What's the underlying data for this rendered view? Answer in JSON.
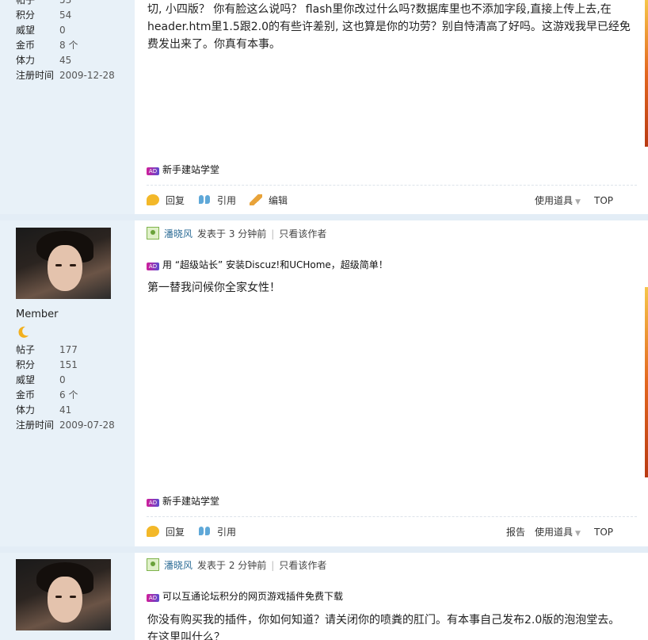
{
  "post1": {
    "stats": [
      {
        "label": "积分",
        "value": "54"
      },
      {
        "label": "威望",
        "value": "0"
      },
      {
        "label": "金币",
        "value": "8 个"
      },
      {
        "label": "体力",
        "value": "45"
      },
      {
        "label": "注册时间",
        "value": "2009-12-28"
      }
    ],
    "body": "切, 小四版？ 你有脸这么说吗？ flash里你改过什么吗?数据库里也不添加字段,直接上传上去,在header.htm里1.5跟2.0的有些许差别, 这也算是你的功劳？别自恃清高了好吗。这游戏我早已经免费发出来了。你真有本事。",
    "ad_bottom": "新手建站学堂",
    "actions": {
      "reply": "回复",
      "quote": "引用",
      "edit": "编辑",
      "tools": "使用道具",
      "top": "TOP"
    }
  },
  "post2": {
    "rank": "Member",
    "stats": [
      {
        "label": "帖子",
        "value": "177"
      },
      {
        "label": "积分",
        "value": "151"
      },
      {
        "label": "威望",
        "value": "0"
      },
      {
        "label": "金币",
        "value": "6 个"
      },
      {
        "label": "体力",
        "value": "41"
      },
      {
        "label": "注册时间",
        "value": "2009-07-28"
      }
    ],
    "author": "潘晓风",
    "posted": "发表于  3 分钟前",
    "only_author": "只看该作者",
    "ad_top": "用 “超级站长” 安装Discuz!和UCHome，超级简单！",
    "body": "第一替我问候你全家女性！",
    "ad_bottom": "新手建站学堂",
    "actions": {
      "reply": "回复",
      "quote": "引用",
      "report": "报告",
      "tools": "使用道具",
      "top": "TOP"
    }
  },
  "post3": {
    "author": "潘晓风",
    "posted": "发表于  2 分钟前",
    "only_author": "只看该作者",
    "ad_top": "可以互通论坛积分的网页游戏插件免费下载",
    "body": "你没有购买我的插件，你如何知道？请关闭你的喷粪的肛门。有本事自己发布2.0版的泡泡堂去。在这里叫什么？"
  },
  "ad_badge": "AD",
  "colors": {
    "sidebar": "#e8f1f8",
    "author": "#2f6e97",
    "separator": "#e3edf6"
  }
}
